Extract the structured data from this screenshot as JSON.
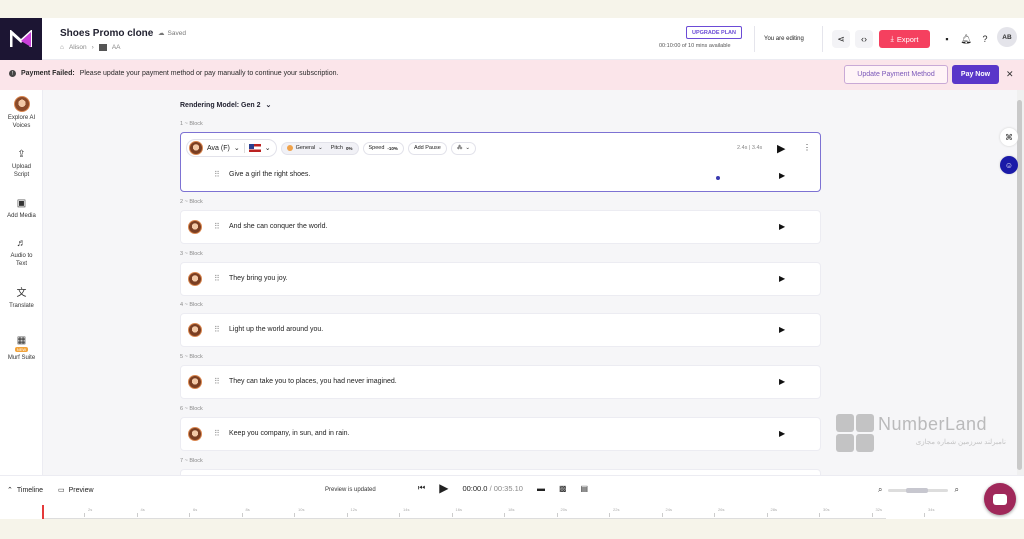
{
  "header": {
    "project_title": "Shoes Promo clone",
    "saved_label": "Saved",
    "breadcrumb_user": "Alison",
    "breadcrumb_folder": "AA",
    "upgrade_label": "UPGRADE PLAN",
    "usage_text": "00:10:00 of 10 mins available",
    "editing_status": "You are editing",
    "export_label": "Export",
    "avatar_initials": "AB",
    "export_color": "#f5405f"
  },
  "banner": {
    "title": "Payment Failed:",
    "message": "Please update your payment method or pay manually to continue your subscription.",
    "update_label": "Update Payment Method",
    "pay_label": "Pay Now"
  },
  "sidebar": {
    "items": [
      {
        "label": "Explore AI Voices",
        "icon": "ai-voice-avatar"
      },
      {
        "label": "Upload Script",
        "icon": "upload-script-icon"
      },
      {
        "label": "Add Media",
        "icon": "add-media-icon"
      },
      {
        "label": "Audio to Text",
        "icon": "audio-to-text-icon"
      },
      {
        "label": "Translate",
        "icon": "translate-icon"
      },
      {
        "label": "Murf Suite",
        "icon": "murf-suite-icon",
        "badge": "NEW"
      }
    ]
  },
  "editor": {
    "rendering_model": "Rendering Model: Gen 2",
    "active_block": {
      "voice": "Ava (F)",
      "style": "General",
      "pitch_label": "Pitch",
      "pitch_value": "0%",
      "speed_label": "Speed",
      "speed_value": "-10%",
      "pause_label": "Add Pause",
      "duration": "2.4s | 3.4s"
    },
    "blocks": [
      {
        "index": "1 ~",
        "label": "Block",
        "text": "Give a girl the right shoes."
      },
      {
        "index": "2 ~",
        "label": "Block",
        "text": "And she can conquer the world."
      },
      {
        "index": "3 ~",
        "label": "Block",
        "text": "They bring you joy."
      },
      {
        "index": "4 ~",
        "label": "Block",
        "text": "Light up the world around you."
      },
      {
        "index": "5 ~",
        "label": "Block",
        "text": "They can take you to places, you had never imagined."
      },
      {
        "index": "6 ~",
        "label": "Block",
        "text": "Keep you company, in sun, and in rain."
      },
      {
        "index": "7 ~",
        "label": "Block",
        "text": ""
      }
    ]
  },
  "bottom": {
    "timeline_label": "Timeline",
    "preview_label": "Preview",
    "preview_status": "Preview is updated",
    "current_time": "00:00.0",
    "total_time": "/ 00:35.10"
  },
  "ruler_ticks": [
    "2s",
    "4s",
    "6s",
    "8s",
    "10s",
    "12s",
    "14s",
    "16s",
    "18s",
    "20s",
    "22s",
    "24s",
    "26s",
    "28s",
    "30s",
    "32s",
    "34s"
  ],
  "watermark": {
    "name": "NumberLand",
    "subtitle": "نامبرلند سرزمین شماره مجازی"
  }
}
